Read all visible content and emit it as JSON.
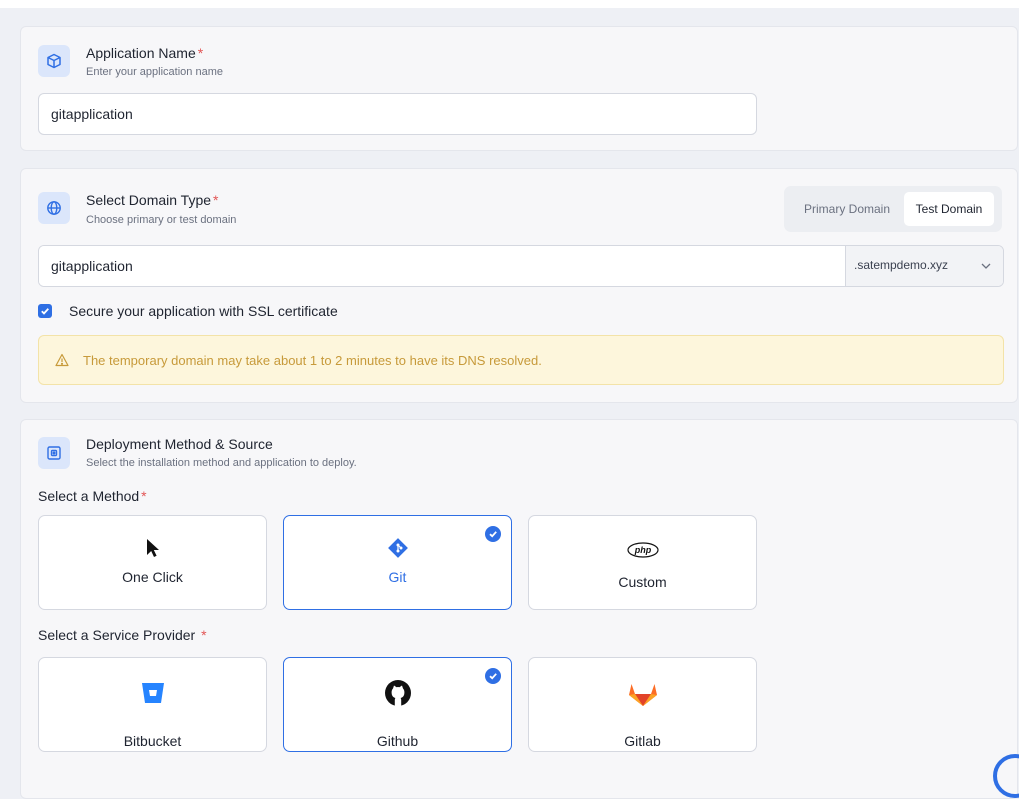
{
  "app": {
    "title": "Application Name",
    "required_mark": "*",
    "subtitle": "Enter your application name",
    "input_value": "gitapplication"
  },
  "domain": {
    "title": "Select Domain Type",
    "required_mark": "*",
    "subtitle": "Choose primary or test domain",
    "toggle": {
      "primary": "Primary Domain",
      "test": "Test Domain",
      "selected": "test"
    },
    "input_value": "gitapplication",
    "suffix": ".satempdemo.xyz",
    "ssl_label": "Secure your application with SSL certificate",
    "ssl_checked": true,
    "warning": "The temporary domain may take about 1 to 2 minutes to have its DNS resolved."
  },
  "deploy": {
    "title": "Deployment Method & Source",
    "subtitle": "Select the installation method and application to deploy.",
    "method_label": "Select a Method",
    "method_required": "*",
    "methods": [
      {
        "label": "One Click",
        "icon": "cursor-icon",
        "selected": false
      },
      {
        "label": "Git",
        "icon": "git-icon",
        "selected": true
      },
      {
        "label": "Custom",
        "icon": "php-icon",
        "selected": false
      }
    ],
    "provider_label": "Select a Service Provider",
    "provider_required": "*",
    "providers": [
      {
        "label": "Bitbucket",
        "icon": "bitbucket-icon",
        "selected": false
      },
      {
        "label": "Github",
        "icon": "github-icon",
        "selected": true
      },
      {
        "label": "Gitlab",
        "icon": "gitlab-icon",
        "selected": false
      }
    ]
  },
  "colors": {
    "accent": "#2f6fe4",
    "required": "#e25555",
    "warning_bg": "#fdf6dc",
    "warning_text": "#c79a3a",
    "icon_bg": "#dbe6fb"
  }
}
